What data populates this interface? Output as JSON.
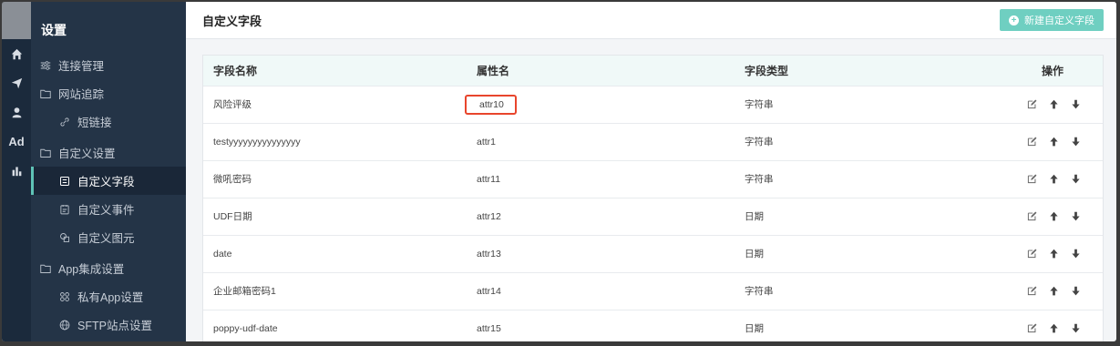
{
  "sidebar": {
    "title": "设置",
    "items": [
      {
        "label": "连接管理",
        "icon": "sliders-icon",
        "level": 1
      },
      {
        "label": "网站追踪",
        "icon": "folder-icon",
        "level": 1
      },
      {
        "label": "短链接",
        "icon": "link-icon",
        "level": 2
      },
      {
        "label": "自定义设置",
        "icon": "folder-icon",
        "level": 1
      },
      {
        "label": "自定义字段",
        "icon": "field-icon",
        "level": 2,
        "active": true
      },
      {
        "label": "自定义事件",
        "icon": "event-icon",
        "level": 2
      },
      {
        "label": "自定义图元",
        "icon": "shapes-icon",
        "level": 2
      },
      {
        "label": "App集成设置",
        "icon": "folder-icon",
        "level": 1
      },
      {
        "label": "私有App设置",
        "icon": "apps-icon",
        "level": 2
      },
      {
        "label": "SFTP站点设置",
        "icon": "globe-icon",
        "level": 2
      }
    ]
  },
  "rail": {
    "icons": [
      {
        "name": "home-icon",
        "glyph": "⌂"
      },
      {
        "name": "send-icon",
        "glyph": "➤"
      },
      {
        "name": "user-icon",
        "glyph": "●"
      },
      {
        "name": "ad-icon",
        "glyph": "Ad"
      },
      {
        "name": "bar-chart-icon",
        "glyph": "▥"
      }
    ]
  },
  "header": {
    "title": "自定义字段",
    "new_button_label": "新建自定义字段"
  },
  "table": {
    "columns": [
      "字段名称",
      "属性名",
      "字段类型",
      "操作"
    ],
    "rows": [
      {
        "name": "风险评级",
        "attr": "attr10",
        "type": "字符串",
        "highlight": true
      },
      {
        "name": "testyyyyyyyyyyyyyyy",
        "attr": "attr1",
        "type": "字符串"
      },
      {
        "name": "微吼密码",
        "attr": "attr11",
        "type": "字符串"
      },
      {
        "name": "UDF日期",
        "attr": "attr12",
        "type": "日期"
      },
      {
        "name": "date",
        "attr": "attr13",
        "type": "日期"
      },
      {
        "name": "企业邮箱密码1",
        "attr": "attr14",
        "type": "字符串"
      },
      {
        "name": "poppy-udf-date",
        "attr": "attr15",
        "type": "日期"
      }
    ]
  },
  "colors": {
    "accent": "#6fcfc1",
    "highlight_border": "#e8452c",
    "sidebar_bg": "#243447"
  }
}
